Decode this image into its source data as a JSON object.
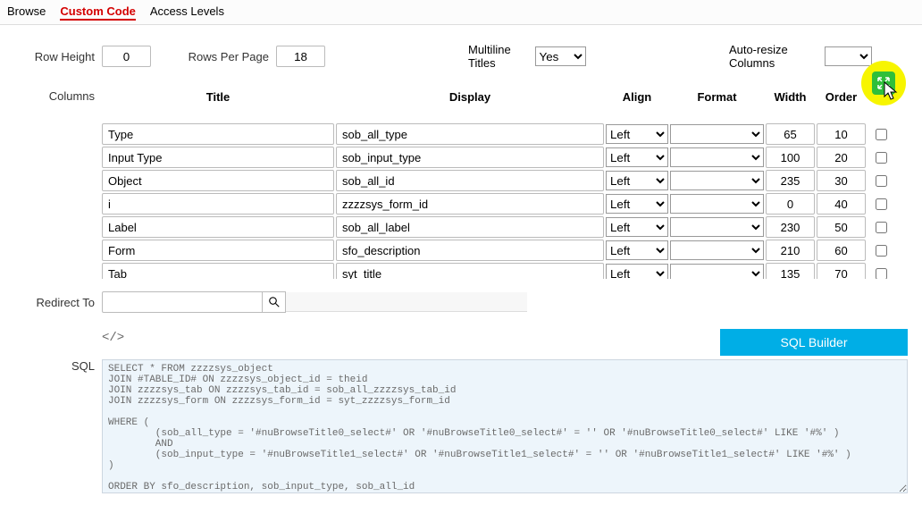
{
  "tabs": {
    "browse": "Browse",
    "custom_code": "Custom Code",
    "access_levels": "Access Levels"
  },
  "settings": {
    "row_height_label": "Row Height",
    "row_height_value": "0",
    "rows_per_page_label": "Rows Per Page",
    "rows_per_page_value": "18",
    "multiline_titles_label": "Multiline Titles",
    "multiline_titles_value": "Yes",
    "auto_resize_label": "Auto-resize Columns",
    "auto_resize_value": ""
  },
  "columns": {
    "section_label": "Columns",
    "headers": {
      "title": "Title",
      "display": "Display",
      "align": "Align",
      "format": "Format",
      "width": "Width",
      "order": "Order"
    },
    "rows": [
      {
        "title": "Type",
        "display": "sob_all_type",
        "align": "Left",
        "format": "",
        "width": "65",
        "order": "10"
      },
      {
        "title": "Input Type",
        "display": "sob_input_type",
        "align": "Left",
        "format": "",
        "width": "100",
        "order": "20"
      },
      {
        "title": "Object",
        "display": "sob_all_id",
        "align": "Left",
        "format": "",
        "width": "235",
        "order": "30"
      },
      {
        "title": "i",
        "display": "zzzzsys_form_id",
        "align": "Left",
        "format": "",
        "width": "0",
        "order": "40"
      },
      {
        "title": "Label",
        "display": "sob_all_label",
        "align": "Left",
        "format": "",
        "width": "230",
        "order": "50"
      },
      {
        "title": "Form",
        "display": "sfo_description",
        "align": "Left",
        "format": "",
        "width": "210",
        "order": "60"
      },
      {
        "title": "Tab",
        "display": "syt_title",
        "align": "Left",
        "format": "",
        "width": "135",
        "order": "70"
      }
    ]
  },
  "redirect": {
    "label": "Redirect To",
    "value": "",
    "icon": "search-icon"
  },
  "sql": {
    "label": "SQL",
    "code_icon_text": "</>",
    "button_label": "SQL Builder",
    "content": "SELECT * FROM zzzzsys_object\nJOIN #TABLE_ID# ON zzzzsys_object_id = theid\nJOIN zzzzsys_tab ON zzzzsys_tab_id = sob_all_zzzzsys_tab_id\nJOIN zzzzsys_form ON zzzzsys_form_id = syt_zzzzsys_form_id\n\nWHERE (\n        (sob_all_type = '#nuBrowseTitle0_select#' OR '#nuBrowseTitle0_select#' = '' OR '#nuBrowseTitle0_select#' LIKE '#%' )\n        AND\n        (sob_input_type = '#nuBrowseTitle1_select#' OR '#nuBrowseTitle1_select#' = '' OR '#nuBrowseTitle1_select#' LIKE '#%' )\n)\n\nORDER BY sfo_description, sob_input_type, sob_all_id"
  }
}
